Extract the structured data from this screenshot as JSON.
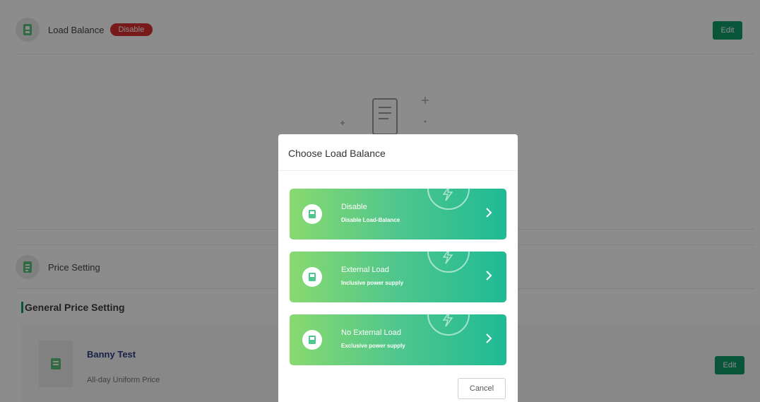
{
  "load_balance": {
    "title": "Load Balance",
    "status": "Disable",
    "edit_label": "Edit"
  },
  "price_setting": {
    "title": "Price Setting",
    "section_title": "General Price Setting",
    "card": {
      "name": "Banny Test",
      "subtitle": "All-day Uniform Price",
      "edit_label": "Edit"
    }
  },
  "modal": {
    "title": "Choose Load Balance",
    "options": [
      {
        "label": "Disable",
        "desc": "Disable Load-Balance"
      },
      {
        "label": "External Load",
        "desc": "Inclusive power supply"
      },
      {
        "label": "No External Load",
        "desc": "Exclusive power supply"
      }
    ],
    "cancel_label": "Cancel"
  },
  "colors": {
    "accent": "#0f9b6b",
    "badge": "#d9302f",
    "card_name": "#2c3c86"
  }
}
